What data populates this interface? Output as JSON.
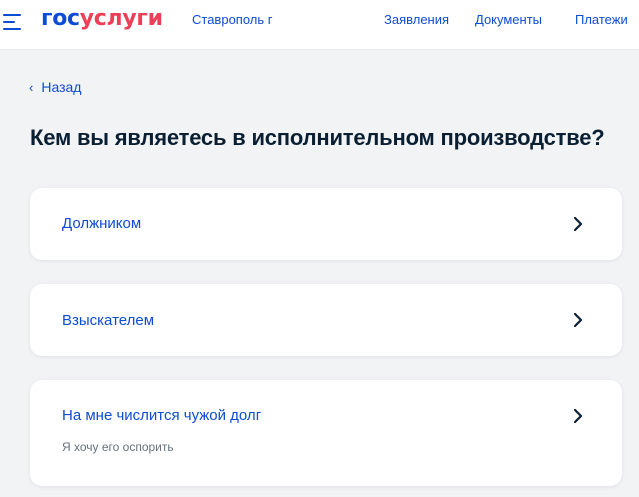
{
  "header": {
    "logo_part1": "гос",
    "logo_part2": "услуги",
    "city": "Ставрополь г",
    "nav": [
      "Заявления",
      "Документы",
      "Платежи"
    ]
  },
  "back_label": "Назад",
  "title": "Кем вы являетесь в исполнительном производстве?",
  "options": [
    {
      "label": "Должником",
      "sub": ""
    },
    {
      "label": "Взыскателем",
      "sub": ""
    },
    {
      "label": "На мне числится чужой долг",
      "sub": "Я хочу его оспорить"
    }
  ],
  "colors": {
    "brand_blue": "#0d4cd3",
    "brand_red": "#ee3f58",
    "background": "#f2f3f5",
    "text": "#0b1f33",
    "secondary_text": "#66727f"
  }
}
